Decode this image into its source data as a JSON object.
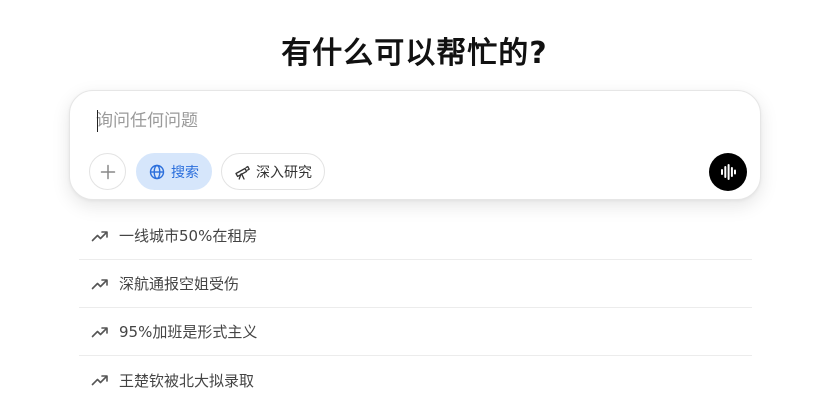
{
  "heading": "有什么可以帮忙的?",
  "composer": {
    "placeholder": "询问任何问题",
    "value": "",
    "add_icon": "plus-icon",
    "search_label": "搜索",
    "search_icon": "globe-icon",
    "deep_research_label": "深入研究",
    "deep_research_icon": "telescope-icon",
    "voice_icon": "voice-waveform-icon"
  },
  "trends": {
    "icon": "trending-up-icon",
    "items": [
      {
        "text": "一线城市50%在租房"
      },
      {
        "text": "深航通报空姐受伤"
      },
      {
        "text": "95%加班是形式主义"
      },
      {
        "text": "王楚钦被北大拟录取"
      }
    ]
  },
  "colors": {
    "accent": "#2b6fdc",
    "search_pill_bg": "#d6e6fb",
    "voice_btn_bg": "#000000"
  }
}
